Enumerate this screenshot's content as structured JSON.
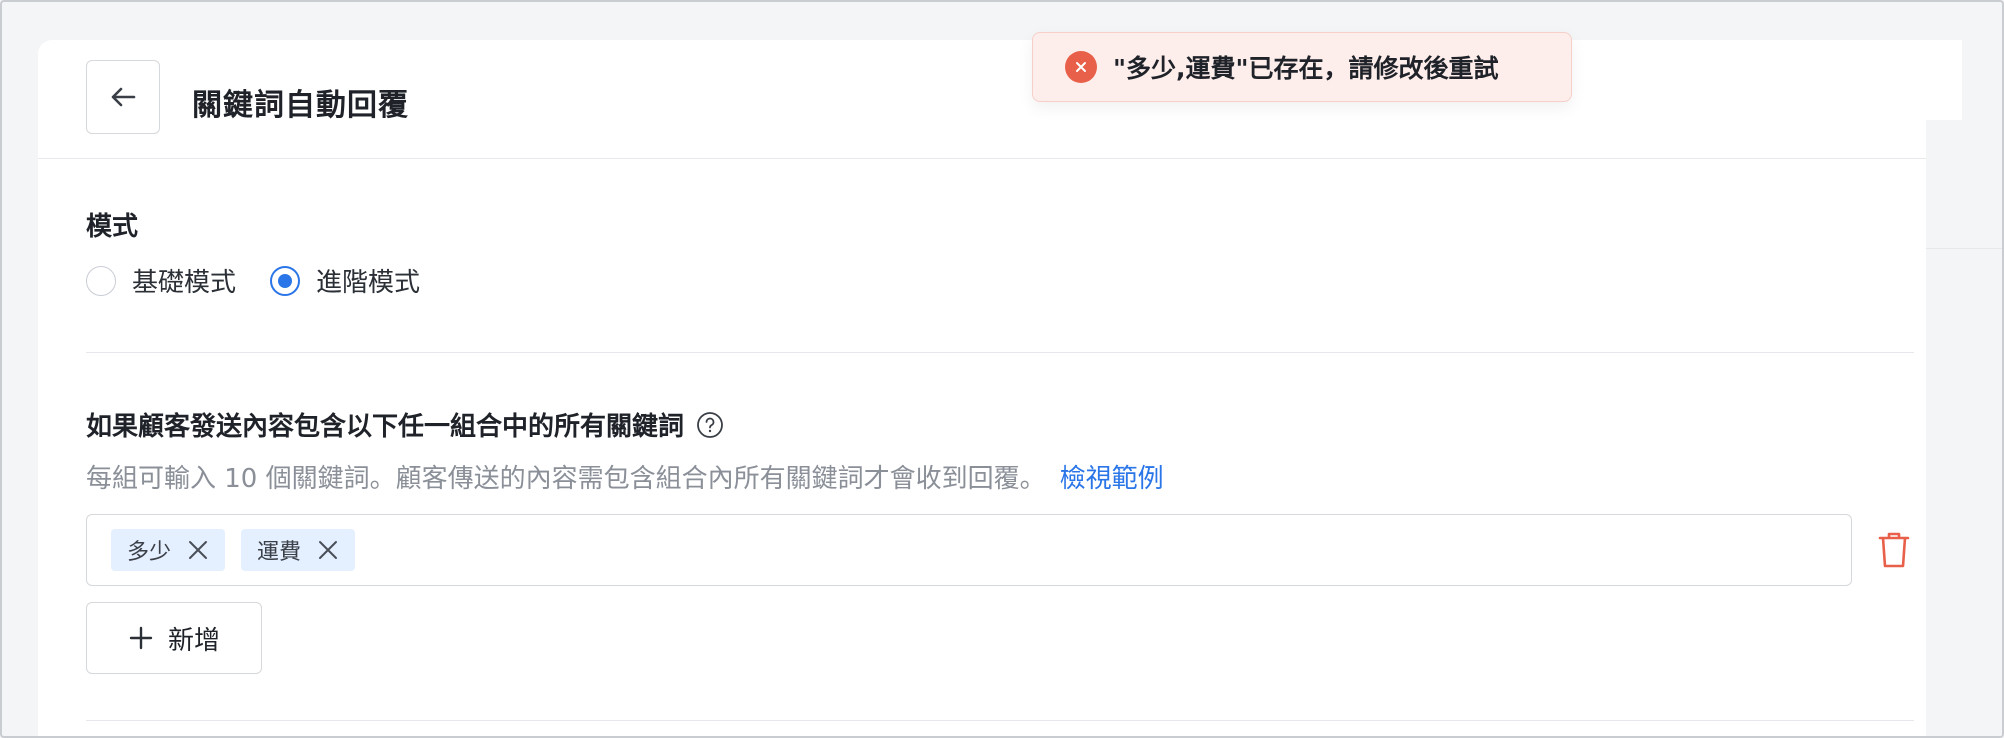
{
  "header": {
    "title": "關鍵詞自動回覆",
    "back_icon": "arrow-left-icon"
  },
  "mode": {
    "label": "模式",
    "options": [
      {
        "label": "基礎模式",
        "selected": false
      },
      {
        "label": "進階模式",
        "selected": true
      }
    ]
  },
  "rule": {
    "title": "如果顧客發送內容包含以下任一組合中的所有關鍵詞",
    "description": "每組可輸入 10 個關鍵詞。顧客傳送的內容需包含組合內所有關鍵詞才會收到回覆。",
    "example_link": "檢視範例",
    "tags": [
      "多少",
      "運費"
    ],
    "add_label": "新增"
  },
  "toast": {
    "message": "\"多少,運費\"已存在，請修改後重試",
    "type": "error"
  },
  "colors": {
    "accent": "#2a76e8",
    "error": "#e8604a",
    "tag_bg": "#e4efff"
  }
}
